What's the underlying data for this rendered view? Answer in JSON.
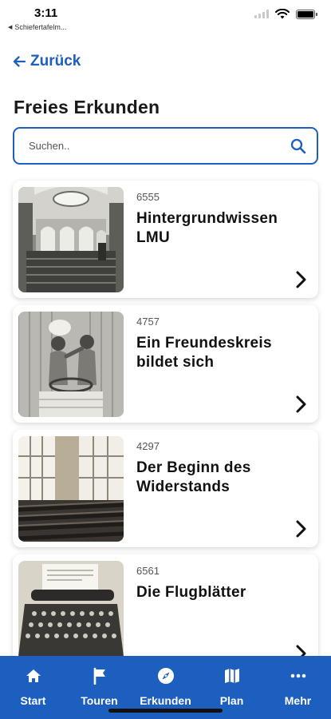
{
  "status_bar": {
    "time": "3:11",
    "back_app": "Schiefertafelm..."
  },
  "header": {
    "back_label": "Zurück",
    "title": "Freies Erkunden"
  },
  "search": {
    "placeholder": "Suchen..",
    "value": ""
  },
  "items": [
    {
      "number": "6555",
      "title": "Hintergrundwissen LMU",
      "image": "lecture-hall-photo"
    },
    {
      "number": "4757",
      "title": "Ein Freundeskreis bildet sich",
      "image": "friends-photo"
    },
    {
      "number": "4297",
      "title": "Der Beginn des Widerstands",
      "image": "classroom-photo"
    },
    {
      "number": "6561",
      "title": "Die Flugblätter",
      "image": "typewriter-photo"
    }
  ],
  "nav": [
    {
      "label": "Start",
      "icon": "home-icon"
    },
    {
      "label": "Touren",
      "icon": "flag-icon"
    },
    {
      "label": "Erkunden",
      "icon": "compass-icon"
    },
    {
      "label": "Plan",
      "icon": "map-icon"
    },
    {
      "label": "Mehr",
      "icon": "more-icon"
    }
  ],
  "colors": {
    "accent": "#1d5fbf",
    "nav_background": "#1d5fbf"
  }
}
